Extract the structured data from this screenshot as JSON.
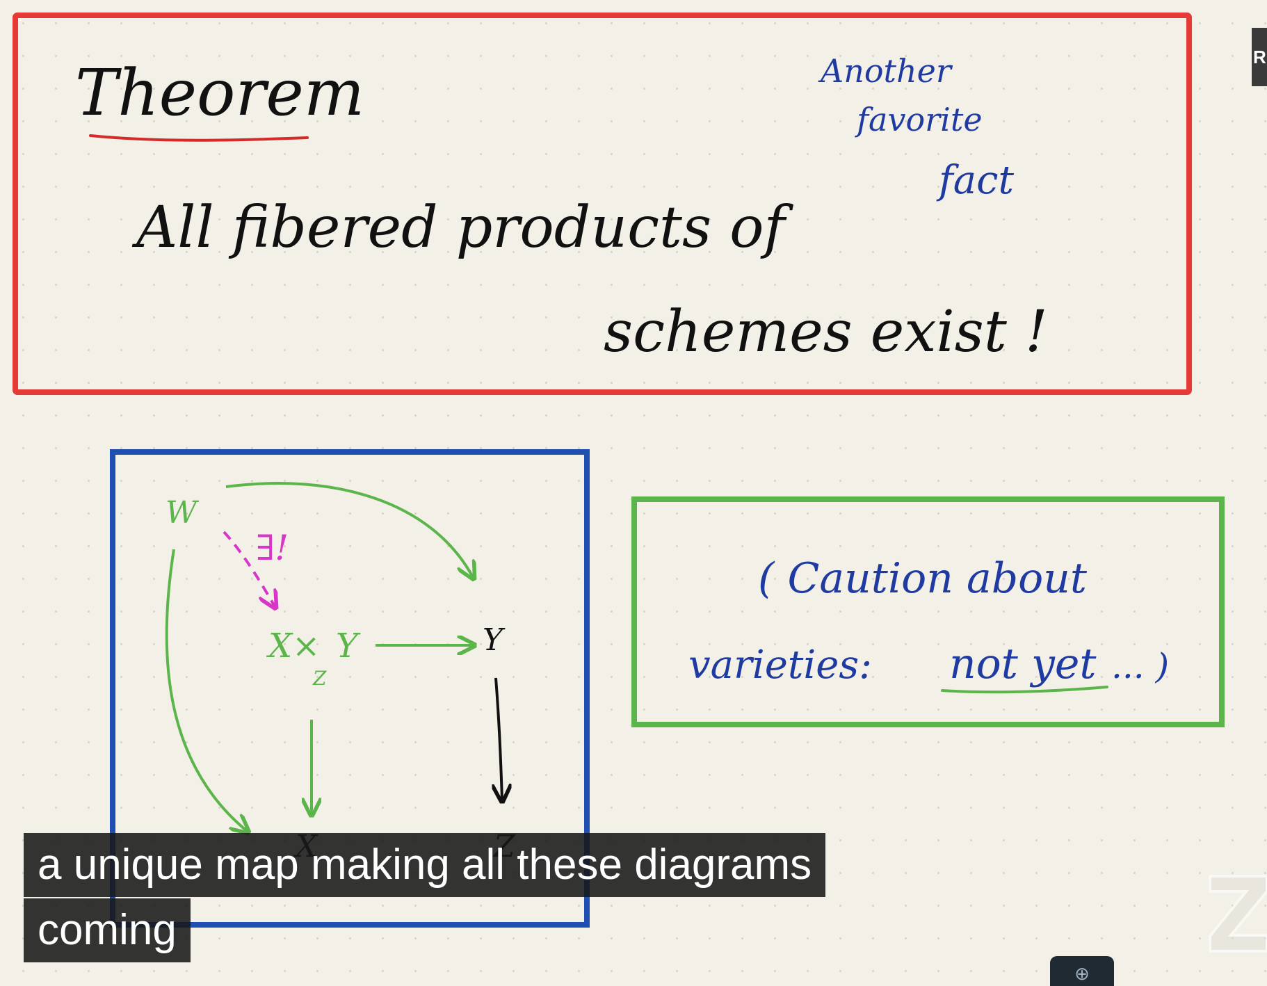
{
  "theorem_box": {
    "heading": "Theorem",
    "statement_line_1": "All fibered products of",
    "statement_line_2": "schemes exist !",
    "margin_note_line_1": "Another",
    "margin_note_line_2": "favorite",
    "margin_note_line_3": "fact"
  },
  "diagram_box": {
    "node_w": "W",
    "exists_unique": "∃!",
    "node_fiber_product": "X×",
    "node_fiber_product_sub": "Z",
    "node_fiber_product_y": "Y",
    "node_y": "Y",
    "node_x": "X",
    "node_z": "Z"
  },
  "caution_box": {
    "line_1": "( Caution about",
    "line_2_prefix": "varieties:",
    "line_2_emphasis": "not yet",
    "line_2_suffix": "... )"
  },
  "subtitles": {
    "line_1": "a unique map making all these diagrams",
    "line_2": "coming"
  },
  "ui": {
    "side_tag_letter": "R",
    "zoom_icon_glyph": "⊕"
  },
  "colors": {
    "theorem_border": "#e63a36",
    "diagram_border": "#1f4fb0",
    "caution_border": "#5cb54a",
    "ink_black": "#111111",
    "ink_blue": "#1f3aa0",
    "ink_green": "#5cb54a",
    "ink_magenta": "#d836c8"
  }
}
